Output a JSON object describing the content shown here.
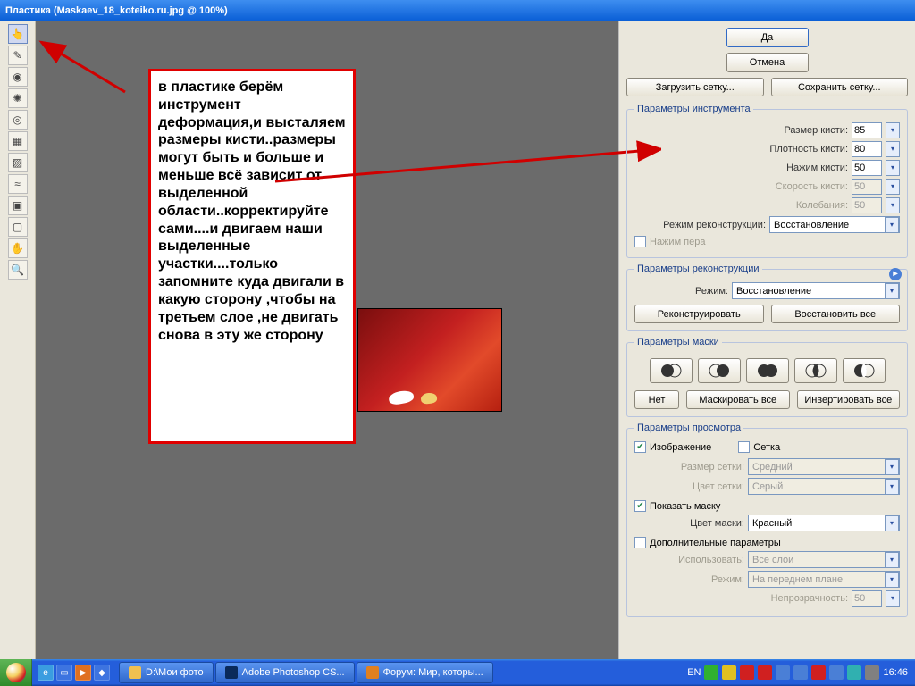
{
  "window": {
    "title": "Пластика (Maskaev_18_koteiko.ru.jpg @ 100%)"
  },
  "annotation": {
    "text": "в пластике берём инструмент деформация,и высталяем размеры кисти..размеры могут быть и больше и меньше всё зависит от выделенной области..корректируйте сами....и двигаем наши выделенные участки....только запомните куда двигали в какую сторону ,чтобы на третьем слое ,не двигать снова в эту же сторону"
  },
  "status": {
    "zoom": "100 %"
  },
  "buttons": {
    "ok": "Да",
    "cancel": "Отмена",
    "load_mesh": "Загрузить сетку...",
    "save_mesh": "Сохранить сетку...",
    "reconstruct": "Реконструировать",
    "restore_all": "Восстановить все",
    "none": "Нет",
    "mask_all": "Маскировать все",
    "invert_all": "Инвертировать все"
  },
  "groups": {
    "tool": "Параметры инструмента",
    "reconstruct": "Параметры реконструкции",
    "mask": "Параметры маски",
    "view": "Параметры просмотра"
  },
  "labels": {
    "brush_size": "Размер кисти:",
    "brush_density": "Плотность кисти:",
    "brush_pressure": "Нажим кисти:",
    "brush_rate": "Скорость кисти:",
    "turbulence": "Колебания:",
    "recon_mode": "Режим реконструкции:",
    "pen_pressure": "Нажим пера",
    "mode": "Режим:",
    "show_image": "Изображение",
    "show_mesh": "Сетка",
    "mesh_size": "Размер сетки:",
    "mesh_color": "Цвет сетки:",
    "show_mask": "Показать маску",
    "mask_color": "Цвет маски:",
    "extra": "Дополнительные параметры",
    "use": "Использовать:",
    "mode2": "Режим:",
    "opacity": "Непрозрачность:"
  },
  "values": {
    "brush_size": "85",
    "brush_density": "80",
    "brush_pressure": "50",
    "brush_rate": "50",
    "turbulence": "50",
    "recon_mode": "Восстановление",
    "mode": "Восстановление",
    "mesh_size": "Средний",
    "mesh_color": "Серый",
    "mask_color": "Красный",
    "use": "Все слои",
    "mode2": "На переднем плане",
    "opacity": "50"
  },
  "taskbar": {
    "lang": "EN",
    "time": "16:46",
    "tasks": [
      {
        "label": "D:\\Мои фото"
      },
      {
        "label": "Adobe Photoshop CS..."
      },
      {
        "label": "Форум: Мир, которы..."
      }
    ]
  }
}
